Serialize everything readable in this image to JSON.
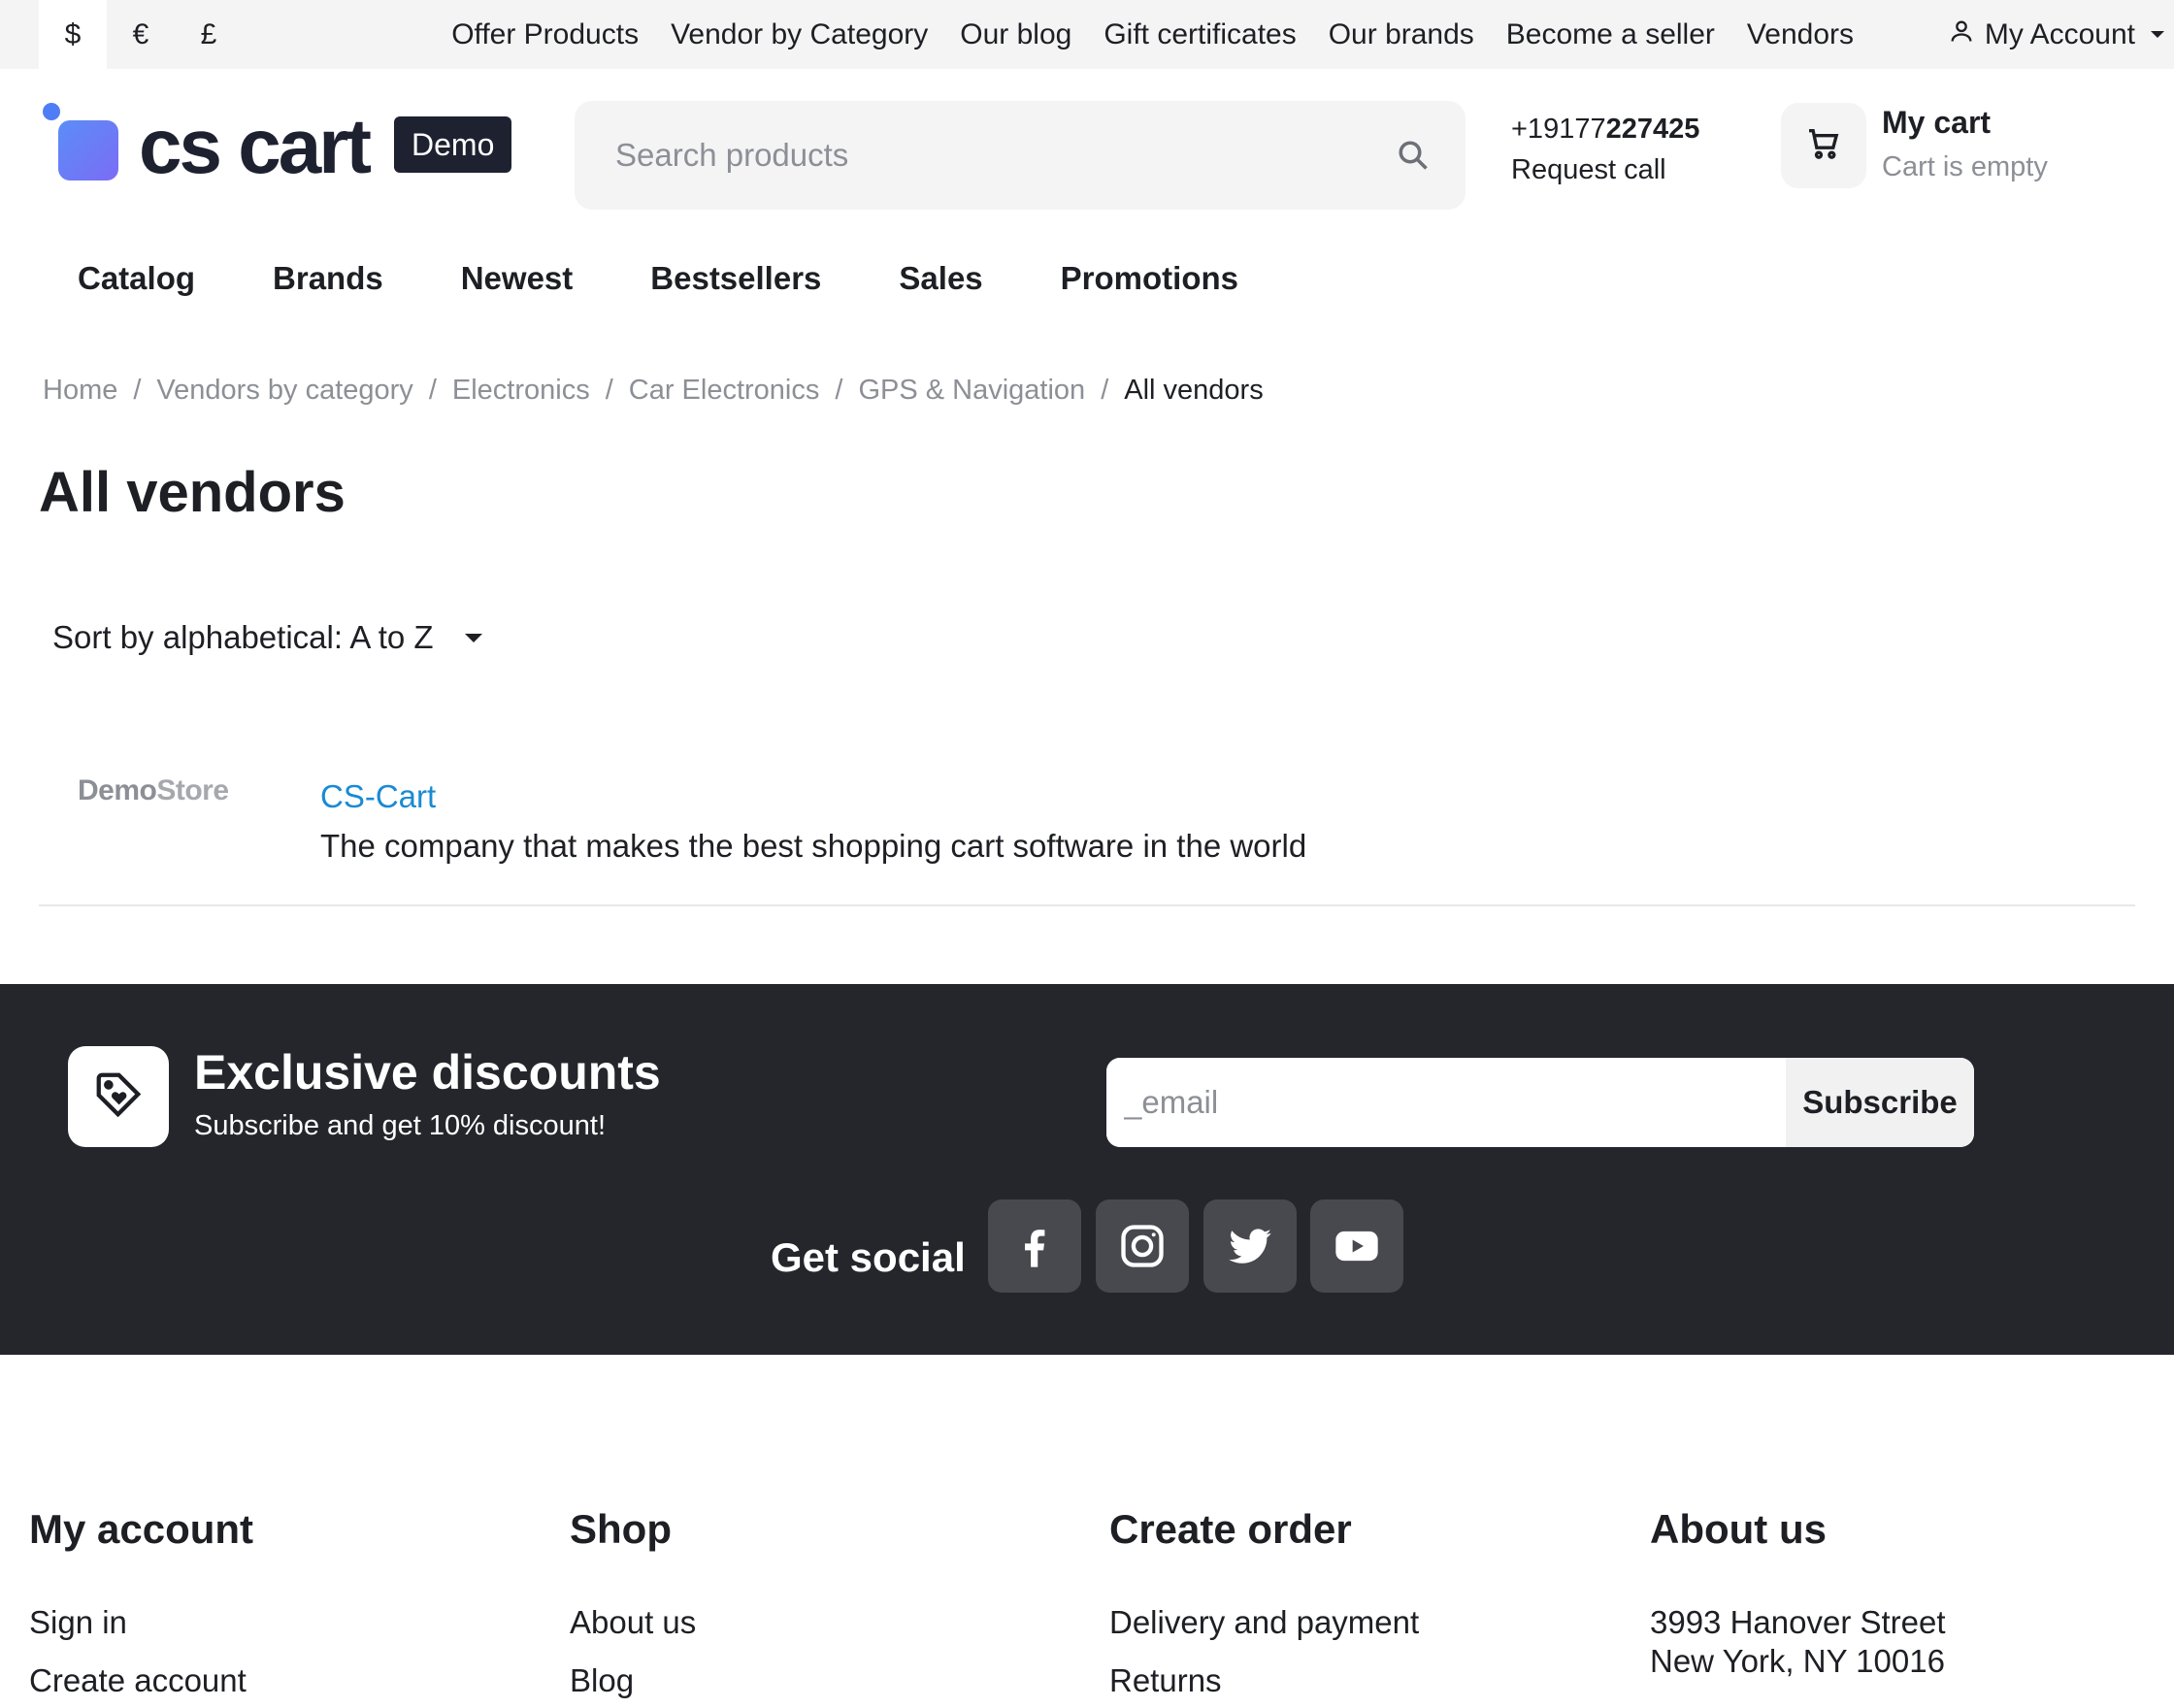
{
  "topbar": {
    "currencies": [
      "$",
      "€",
      "£"
    ],
    "links": [
      "Offer Products",
      "Vendor by Category",
      "Our blog",
      "Gift certificates",
      "Our brands",
      "Become a seller",
      "Vendors"
    ],
    "account_label": "My Account"
  },
  "header": {
    "logo_text": "cs cart",
    "logo_badge": "Demo",
    "search_placeholder": "Search products",
    "phone_prefix": "+19177",
    "phone_bold": "227425",
    "request_call": "Request call",
    "cart_title": "My cart",
    "cart_status": "Cart is empty"
  },
  "nav": [
    "Catalog",
    "Brands",
    "Newest",
    "Bestsellers",
    "Sales",
    "Promotions"
  ],
  "breadcrumb": [
    "Home",
    "Vendors by category",
    "Electronics",
    "Car Electronics",
    "GPS & Navigation",
    "All vendors"
  ],
  "page": {
    "title": "All vendors",
    "sort_label": "Sort by alphabetical: A to Z"
  },
  "vendors": [
    {
      "logo_bold": "Demo",
      "logo_light": "Store",
      "name": "CS-Cart",
      "description": "The company that makes the best shopping cart software in the world"
    }
  ],
  "promo": {
    "title": "Exclusive discounts",
    "subtitle": "Subscribe and get 10% discount!",
    "email_placeholder": "_email",
    "subscribe_label": "Subscribe",
    "social_label": "Get social",
    "social_icons": [
      "facebook-icon",
      "instagram-icon",
      "twitter-icon",
      "youtube-icon"
    ]
  },
  "footer": {
    "my_account": {
      "title": "My account",
      "links": [
        "Sign in",
        "Create account"
      ]
    },
    "shop": {
      "title": "Shop",
      "links": [
        "About us",
        "Blog"
      ]
    },
    "create_order": {
      "title": "Create order",
      "links": [
        "Delivery and payment",
        "Returns"
      ]
    },
    "about_us": {
      "title": "About us",
      "address_line1": "3993 Hanover Street",
      "address_line2": "New York, NY 10016"
    }
  },
  "colors": {
    "dark_band": "#25262b",
    "link_blue": "#1a8ad3",
    "muted": "#8d8f96",
    "logo_blue": "#5b8df6"
  }
}
